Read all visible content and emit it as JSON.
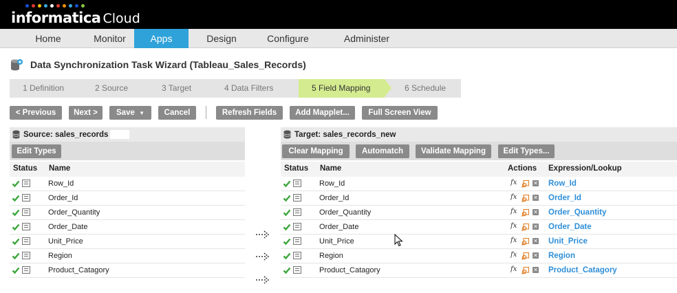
{
  "brand": {
    "name": "informatica",
    "product": "Cloud",
    "dots": [
      "#1a4fcf",
      "#e23a33",
      "#f5c400",
      "#3aa7e0",
      "#ffffff",
      "#e23a33",
      "#f29100",
      "#3aa7e0",
      "#1a4fcf",
      "#8bc53f"
    ]
  },
  "nav": {
    "tabs": [
      "Home",
      "Monitor",
      "Apps",
      "Design",
      "Configure",
      "Administer"
    ],
    "active": "Apps"
  },
  "page": {
    "title": "Data Synchronization Task Wizard (Tableau_Sales_Records)"
  },
  "steps": [
    "1 Definition",
    "2 Source",
    "3 Target",
    "4 Data Filters",
    "5 Field Mapping",
    "6 Schedule"
  ],
  "active_step": "5 Field Mapping",
  "toolbar": {
    "previous": "< Previous",
    "next": "Next >",
    "save": "Save",
    "cancel": "Cancel",
    "refresh_fields": "Refresh Fields",
    "add_mapplet": "Add Mapplet...",
    "full_screen": "Full Screen View"
  },
  "source": {
    "title": "Source: sales_records",
    "edit_types": "Edit Types",
    "col_status": "Status",
    "col_name": "Name",
    "fields": [
      "Row_Id",
      "Order_Id",
      "Order_Quantity",
      "Order_Date",
      "Unit_Price",
      "Region",
      "Product_Catagory"
    ]
  },
  "target": {
    "title": "Target: sales_records_new",
    "buttons": {
      "clear": "Clear Mapping",
      "automatch": "Automatch",
      "validate": "Validate Mapping",
      "edit_types": "Edit Types..."
    },
    "col_status": "Status",
    "col_name": "Name",
    "col_actions": "Actions",
    "col_expression": "Expression/Lookup",
    "fields": [
      {
        "name": "Row_Id",
        "expression": "Row_Id"
      },
      {
        "name": "Order_Id",
        "expression": "Order_Id"
      },
      {
        "name": "Order_Quantity",
        "expression": "Order_Quantity"
      },
      {
        "name": "Order_Date",
        "expression": "Order_Date"
      },
      {
        "name": "Unit_Price",
        "expression": "Unit_Price"
      },
      {
        "name": "Region",
        "expression": "Region"
      },
      {
        "name": "Product_Catagory",
        "expression": "Product_Catagory"
      }
    ],
    "action_icons": [
      "fx-icon",
      "lookup-icon",
      "delete-icon"
    ]
  }
}
